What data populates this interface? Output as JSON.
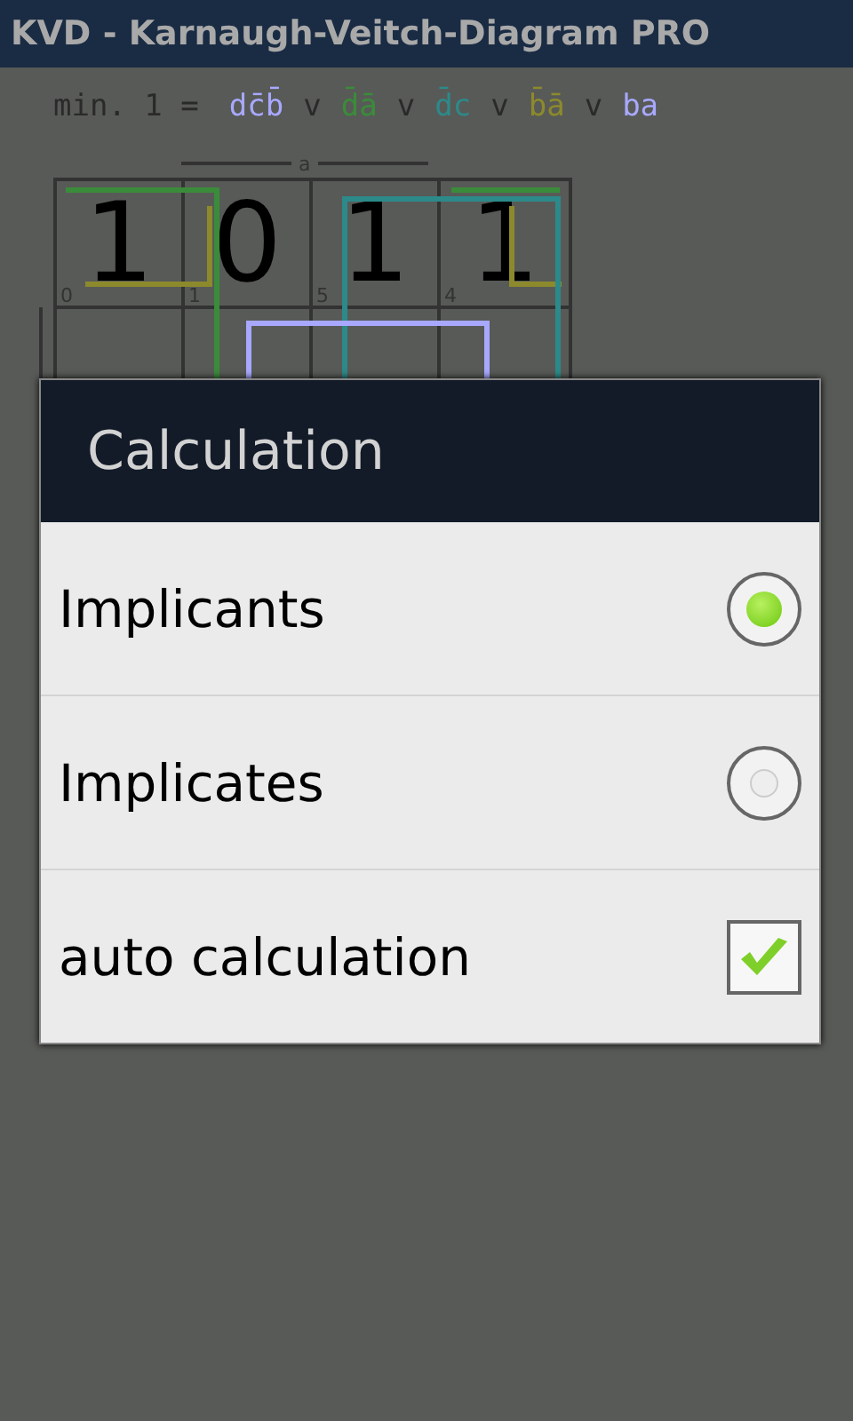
{
  "window": {
    "title": "KVD - Karnaugh-Veitch-Diagram PRO"
  },
  "formula": {
    "prefix": "min. 1 =",
    "separators": [
      "v",
      "v",
      "v",
      "v"
    ],
    "terms": [
      {
        "text": "dc̄b̄",
        "color": "#a8a8ff"
      },
      {
        "text": "d̄ā",
        "color": "#3a8c3a"
      },
      {
        "text": "d̄c",
        "color": "#2c8a8a"
      },
      {
        "text": "b̄ā",
        "color": "#8c8a2c"
      },
      {
        "text": "ba",
        "color": "#a8a8ff"
      }
    ]
  },
  "kmap": {
    "column_label": "a",
    "rows": [
      [
        {
          "value": "1",
          "index": "0"
        },
        {
          "value": "0",
          "index": "1"
        },
        {
          "value": "1",
          "index": "5"
        },
        {
          "value": "1",
          "index": "4"
        }
      ]
    ]
  },
  "dialog": {
    "title": "Calculation",
    "options": [
      {
        "kind": "radio",
        "label": "Implicants",
        "selected": true
      },
      {
        "kind": "radio",
        "label": "Implicates",
        "selected": false
      },
      {
        "kind": "checkbox",
        "label": "auto calculation",
        "checked": true
      }
    ]
  }
}
